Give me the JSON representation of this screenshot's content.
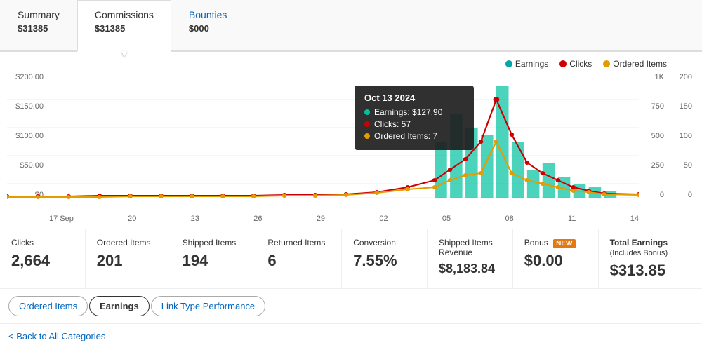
{
  "tabs": [
    {
      "id": "summary",
      "label": "Summary",
      "amount": "313",
      "cents": "85",
      "symbol": "$",
      "active": false
    },
    {
      "id": "commissions",
      "label": "Commissions",
      "amount": "313",
      "cents": "85",
      "symbol": "$",
      "active": true
    },
    {
      "id": "bounties",
      "label": "Bounties",
      "amount": "0",
      "cents": "00",
      "symbol": "$",
      "active": false,
      "link": true
    }
  ],
  "legend": [
    {
      "id": "earnings",
      "label": "Earnings",
      "color": "#00a8a8"
    },
    {
      "id": "clicks",
      "label": "Clicks",
      "color": "#cc0000"
    },
    {
      "id": "ordered-items",
      "label": "Ordered Items",
      "color": "#e49b00"
    }
  ],
  "tooltip": {
    "title": "Oct 13 2024",
    "rows": [
      {
        "label": "Earnings: $127.90",
        "color": "#00c0a0"
      },
      {
        "label": "Clicks: 57",
        "color": "#cc0000"
      },
      {
        "label": "Ordered Items: 7",
        "color": "#e49b00"
      }
    ]
  },
  "y_axis_left": [
    "$200.00",
    "$150.00",
    "$100.00",
    "$50.00",
    "$0"
  ],
  "y_axis_right_clicks": [
    "1K",
    "750",
    "500",
    "250",
    "0"
  ],
  "y_axis_right_items": [
    "200",
    "150",
    "100",
    "50",
    "0"
  ],
  "x_axis": [
    "17 Sep",
    "20",
    "23",
    "26",
    "29",
    "02",
    "05",
    "08",
    "11",
    "14"
  ],
  "stats": [
    {
      "id": "clicks",
      "label": "Clicks",
      "value": "2,664"
    },
    {
      "id": "ordered-items",
      "label": "Ordered Items",
      "value": "201"
    },
    {
      "id": "shipped-items",
      "label": "Shipped Items",
      "value": "194"
    },
    {
      "id": "returned-items",
      "label": "Returned Items",
      "value": "6"
    },
    {
      "id": "conversion",
      "label": "Conversion",
      "value": "7.55%"
    },
    {
      "id": "shipped-revenue",
      "label": "Shipped Items Revenue",
      "value": "$8,183.84"
    },
    {
      "id": "bonus",
      "label": "Bonus",
      "badge": "NEW",
      "value": "$0.00"
    },
    {
      "id": "total-earnings",
      "label": "Total Earnings",
      "sublabel": "(Includes Bonus)",
      "value": "$313.85"
    }
  ],
  "bottom_tabs": [
    {
      "id": "ordered-items",
      "label": "Ordered Items",
      "active": false
    },
    {
      "id": "earnings",
      "label": "Earnings",
      "active": true
    },
    {
      "id": "link-type",
      "label": "Link Type Performance",
      "active": false
    }
  ],
  "back_link": "Back to All Categories"
}
